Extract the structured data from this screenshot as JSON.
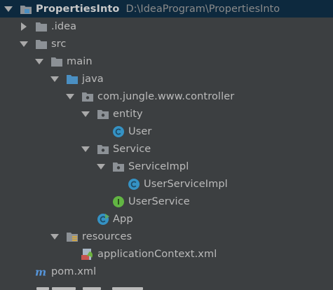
{
  "project_tree": {
    "root": {
      "name": "PropertiesInto",
      "path": "D:\\IdeaProgram\\PropertiesInto"
    },
    "items": [
      {
        "label": "PropertiesInto",
        "type": "module",
        "depth": 0,
        "expanded": true,
        "selected": true
      },
      {
        "label": ".idea",
        "type": "folder-gray",
        "depth": 1,
        "expanded": false
      },
      {
        "label": "src",
        "type": "folder-gray",
        "depth": 1,
        "expanded": true
      },
      {
        "label": "main",
        "type": "folder-gray",
        "depth": 2,
        "expanded": true
      },
      {
        "label": "java",
        "type": "folder-blue",
        "depth": 3,
        "expanded": true
      },
      {
        "label": "com.jungle.www.controller",
        "type": "package",
        "depth": 4,
        "expanded": true
      },
      {
        "label": "entity",
        "type": "package",
        "depth": 5,
        "expanded": true
      },
      {
        "label": "User",
        "type": "class",
        "depth": 6
      },
      {
        "label": "Service",
        "type": "package",
        "depth": 5,
        "expanded": true
      },
      {
        "label": "ServiceImpl",
        "type": "package",
        "depth": 6,
        "expanded": true
      },
      {
        "label": "UserServiceImpl",
        "type": "class",
        "depth": 7
      },
      {
        "label": "UserService",
        "type": "interface",
        "depth": 6
      },
      {
        "label": "App",
        "type": "class-main",
        "depth": 5
      },
      {
        "label": "resources",
        "type": "folder-resources",
        "depth": 3,
        "expanded": true
      },
      {
        "label": "applicationContext.xml",
        "type": "xml-spring",
        "depth": 4
      },
      {
        "label": "pom.xml",
        "type": "maven",
        "depth": 1
      }
    ]
  },
  "colors": {
    "background": "#3c3f41",
    "selection": "#0d293e",
    "text": "#bbbbbb",
    "path_text": "#8a8a8a",
    "folder_gray": "#8c9196",
    "folder_blue": "#4a8fc2",
    "class_blue": "#3592c4",
    "interface_green": "#62b543",
    "maven_blue": "#5594d8"
  }
}
